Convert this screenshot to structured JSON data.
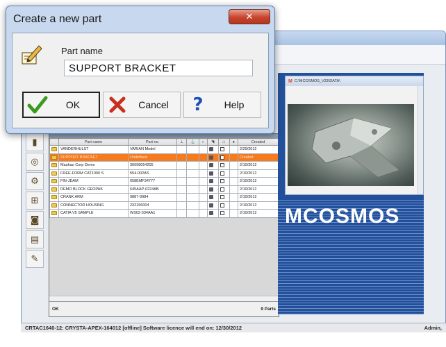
{
  "dialog": {
    "title": "Create a new part",
    "close_label": "✕",
    "field_label": "Part name",
    "part_name_value": "SUPPORT BRACKET",
    "ok_label": "OK",
    "cancel_label": "Cancel",
    "help_label": "Help",
    "icon": "pencil-icon"
  },
  "grid": {
    "columns": [
      "Part name",
      "Part no.",
      "",
      "",
      "",
      "",
      "",
      "",
      "Created"
    ],
    "rows": [
      {
        "name": "VANDERHULST",
        "part_no": "VARIAN Model",
        "created": "2/29/2012",
        "selected": false
      },
      {
        "name": "SUPPORT BRACKET",
        "part_no": "Undefined",
        "created": "Created",
        "selected": true
      },
      {
        "name": "Mauhao Corp Demo",
        "part_no": "36098054205",
        "created": "2/10/2012",
        "selected": false
      },
      {
        "name": "FREE-FORM CAT1000 S",
        "part_no": "554-002AS",
        "created": "2/10/2012",
        "selected": false
      },
      {
        "name": "FIN-JDAM",
        "part_no": "658EMF34777",
        "created": "2/10/2012",
        "selected": false
      },
      {
        "name": "DEMO BLOCK GEOPAK",
        "part_no": "645AAP-0224AB",
        "created": "2/10/2012",
        "selected": false
      },
      {
        "name": "CRANK ARM",
        "part_no": "9887-9984",
        "created": "2/10/2012",
        "selected": false
      },
      {
        "name": "CONNECTOR HOUSING",
        "part_no": "232156004",
        "created": "2/10/2012",
        "selected": false
      },
      {
        "name": "CATIA V5 SAMPLE",
        "part_no": "WS02-334AA1",
        "created": "2/10/2012",
        "selected": false
      }
    ],
    "footer_left": "OK",
    "footer_right": "9 Parts"
  },
  "preview": {
    "title": "C:\\MCOSMOS_V33\\DATA\\",
    "brand": "MCOSMOS"
  },
  "status": {
    "left": "CRTAC1640-12: CRYSTA-APEX-164012 [offline] Software licence will end on: 12/30/2012",
    "right": "Admin,"
  },
  "colors": {
    "selection": "#f47b20",
    "brand_blue": "#23509b",
    "close_red": "#c7452d"
  }
}
